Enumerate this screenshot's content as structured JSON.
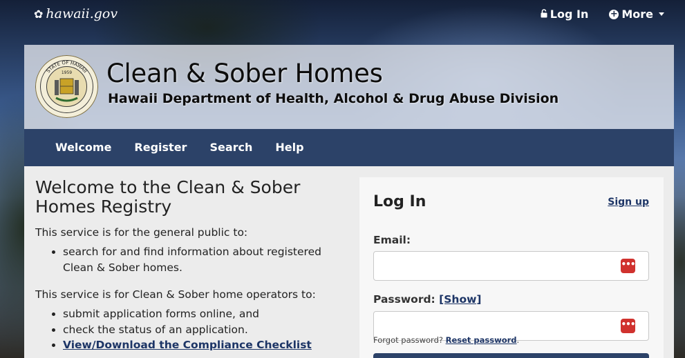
{
  "topbar": {
    "brand": "hawaii.gov",
    "login_label": "Log In",
    "more_label": "More"
  },
  "header": {
    "title": "Clean & Sober Homes",
    "subtitle": "Hawaii Department of Health, Alcohol & Drug Abuse Division",
    "seal_text": "STATE OF HAWAII",
    "seal_year": "1959"
  },
  "nav": {
    "items": [
      "Welcome",
      "Register",
      "Search",
      "Help"
    ]
  },
  "main": {
    "title": "Welcome to the Clean & Sober Homes Registry",
    "public_intro": "This service is for the general public to:",
    "public_items": [
      "search for and find information about registered Clean & Sober homes."
    ],
    "operator_intro": "This service is for Clean & Sober home operators to:",
    "operator_items": [
      "submit application forms online, and",
      "check the status of an application."
    ],
    "checklist_link": "View/Download the Compliance Checklist"
  },
  "login": {
    "title": "Log In",
    "signup_link": "Sign up",
    "email_label": "Email:",
    "email_value": "",
    "password_label": "Password:",
    "show_link": "[Show]",
    "password_value": "",
    "forgot_text": "Forgot password?",
    "reset_link": "Reset password",
    "reset_suffix": "."
  },
  "colors": {
    "navbar": "#2c4268",
    "link": "#1d3566",
    "password_manager_icon": "#d0322e"
  }
}
